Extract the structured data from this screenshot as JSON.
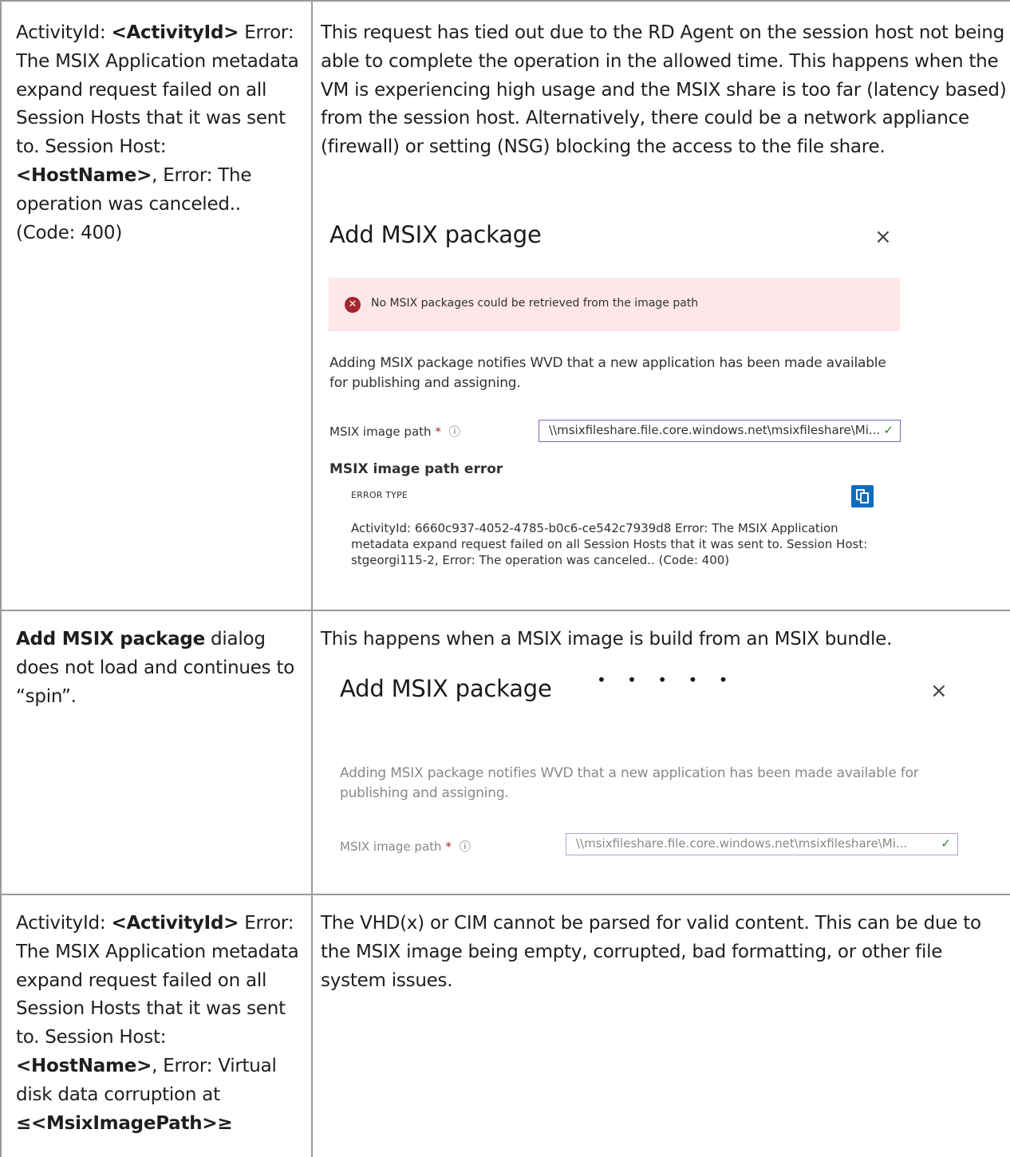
{
  "rows": [
    {
      "left_html": "ActivityId: <b>&lt;ActivityId&gt;</b>  Error: The MSIX Application metadata expand request failed on all Session Hosts that it was sent to. Session Host: <b>&lt;HostName&gt;</b>, Error: The operation was canceled.. (Code: 400)",
      "right_text": "This request has tied out due to the RD Agent on the session host not being able to complete the operation in the allowed time. This happens when the VM is experiencing high usage and the MSIX share is too far (latency based) from the session host. Alternatively, there could be a network appliance (firewall) or setting (NSG) blocking the access to the file share."
    },
    {
      "left_html": "<b>Add MSIX package</b> dialog does not load and continues to “spin”.",
      "right_text": "This happens when a MSIX image is build from an MSIX bundle."
    },
    {
      "left_html": "ActivityId: <b>&lt;ActivityId&gt;</b> Error: The MSIX Application metadata expand request failed on all Session Hosts that it was sent to. Session Host: <b>&lt;HostName&gt;</b>, Error: Virtual disk data corruption at <b>≤&lt;MsixImagePath&gt;≥</b>",
      "right_text": "The VHD(x) or CIM cannot be parsed for valid content. This can be due to the MSIX image being empty, corrupted, bad formatting, or other file system issues."
    }
  ],
  "dialog1": {
    "title": "Add MSIX package",
    "close_glyph": "×",
    "error_banner": "No MSIX packages could be retrieved from the image path",
    "description": "Adding MSIX package notifies WVD that a new application has been made available for publishing and assigning.",
    "path_label": "MSIX image path",
    "required_mark": "*",
    "info_glyph": "ⓘ",
    "path_value": "\\\\msixfileshare.file.core.windows.net\\msixfileshare\\Mi...",
    "check_glyph": "✓",
    "error_heading": "MSIX image path error",
    "error_type_label": "ERROR TYPE",
    "error_details": "ActivityId: 6660c937-4052-4785-b0c6-ce542c7939d8 Error: The MSIX Application metadata expand request failed on all Session Hosts that it was sent to. Session Host: stgeorgi115-2, Error: The operation was canceled.. (Code: 400)"
  },
  "dialog2": {
    "title": "Add MSIX package",
    "loading_dots": "• • • • •",
    "close_glyph": "×",
    "description": "Adding MSIX package notifies WVD that a new application has been made available for publishing and assigning.",
    "path_label": "MSIX image path",
    "required_mark": "*",
    "info_glyph": "ⓘ",
    "path_value": "\\\\msixfileshare.file.core.windows.net\\msixfileshare\\Mi...",
    "check_glyph": "✓"
  }
}
